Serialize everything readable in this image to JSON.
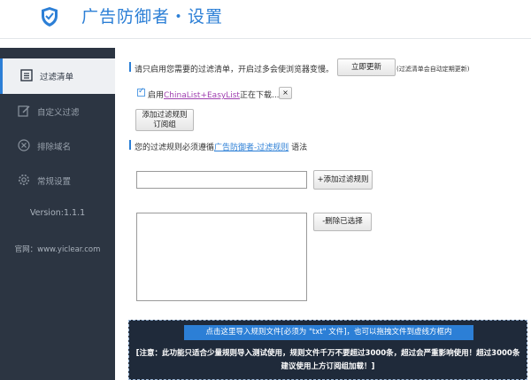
{
  "header": {
    "title": "广告防御者・设置"
  },
  "sidebar": {
    "items": [
      {
        "label": "过滤清单"
      },
      {
        "label": "自定义过滤"
      },
      {
        "label": "排除域名"
      },
      {
        "label": "常规设置"
      }
    ],
    "version": "Version:1.1.1",
    "website": "官网：www.yiclear.com"
  },
  "main": {
    "notice_text": "请只启用您需要的过滤清单，开启过多会使浏览器变慢。",
    "update_button": "立即更新",
    "update_note": "(过滤清单会自动定期更新)",
    "enable_prefix": "启用",
    "list_link": "ChinaList+EasyList",
    "download_status": "正在下载......",
    "close_button": "×",
    "add_group_button_line1": "添加过滤规则",
    "add_group_button_line2": "订阅组",
    "rule_prefix": "您的过滤规则必须遵循",
    "rule_link": "广告防御者-过滤规则",
    "rule_suffix": "语法",
    "rule_input_value": "",
    "add_rule_button": "+添加过滤规则",
    "delete_button": "-删除已选择",
    "import_button": "点击这里导入规则文件[必须为 \"txt\" 文件]，也可以拖拽文件到虚线方框内",
    "import_note": "[注意：此功能只适合少量规则导入测试使用，规则文件千万不要超过3000条，超过会严重影响使用！超过3000条建议使用上方订阅组加载！]"
  }
}
